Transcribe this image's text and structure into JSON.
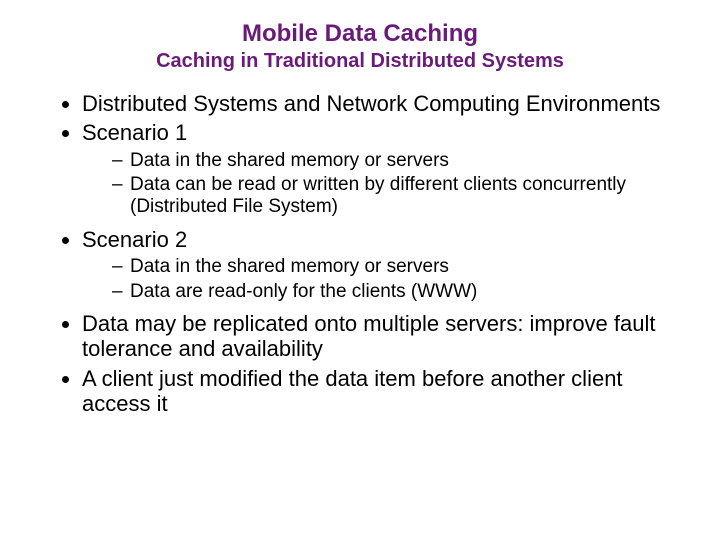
{
  "title": "Mobile Data Caching",
  "subtitle": "Caching in Traditional Distributed Systems",
  "bullets": {
    "b1": "Distributed Systems and Network Computing Environments",
    "b2": "Scenario 1",
    "b2s1": "Data in the shared memory or servers",
    "b2s2": "Data can be read or written by different clients concurrently (Distributed File System)",
    "b3": "Scenario 2",
    "b3s1": "Data in the shared memory or servers",
    "b3s2": "Data are read-only for the clients (WWW)",
    "b4": "Data may be replicated onto multiple servers: improve fault tolerance and availability",
    "b5": "A client just modified the data item before another client access it"
  }
}
